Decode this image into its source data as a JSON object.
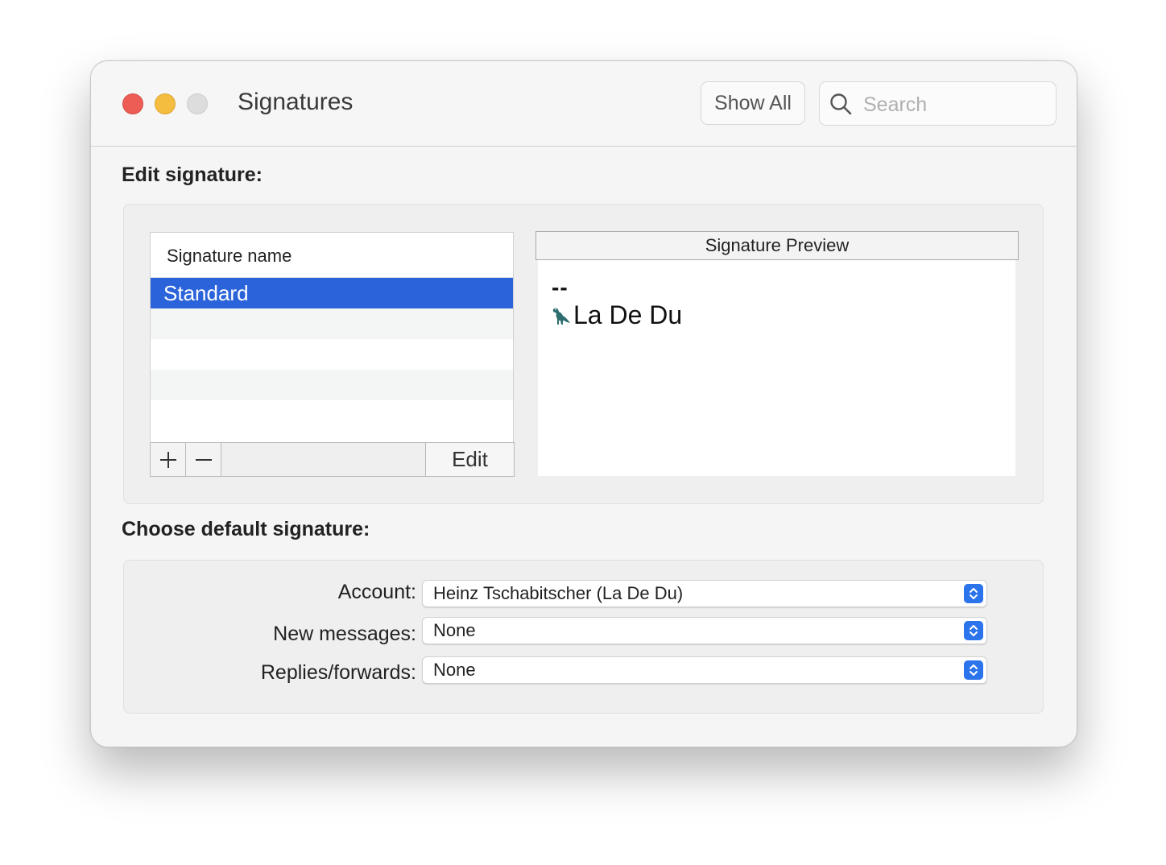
{
  "window": {
    "title": "Signatures"
  },
  "toolbar": {
    "show_all_label": "Show All",
    "search_placeholder": "Search"
  },
  "edit_section": {
    "heading": "Edit signature:",
    "list": {
      "column_header": "Signature name",
      "items": [
        {
          "label": "Standard",
          "selected": true
        }
      ]
    },
    "buttons": {
      "add": "+",
      "remove": "—",
      "edit": "Edit"
    },
    "preview": {
      "header": "Signature Preview",
      "separator": "--",
      "icon": "dinosaur-icon",
      "name": "La De Du"
    }
  },
  "default_section": {
    "heading": "Choose default signature:",
    "account": {
      "label": "Account:",
      "value": "Heinz Tschabitscher (La De Du)"
    },
    "new_messages": {
      "label": "New messages:",
      "value": "None"
    },
    "replies_forwards": {
      "label": "Replies/forwards:",
      "value": "None"
    }
  },
  "colors": {
    "selection": "#2b63da",
    "close": "#ee5d55",
    "minimize": "#f5bd3f",
    "zoom_disabled": "#dddddd",
    "popup_accent": "#2b74ec"
  }
}
